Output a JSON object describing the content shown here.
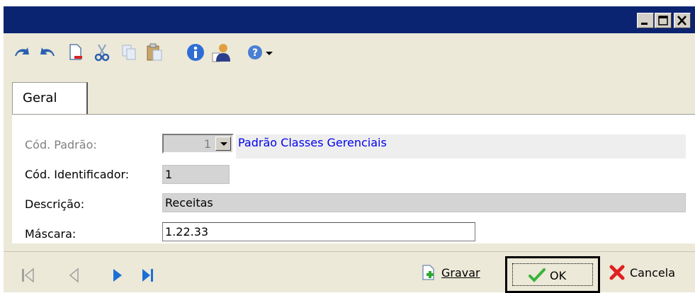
{
  "window": {
    "controls": [
      "minimize-icon",
      "maximize-icon",
      "close-icon"
    ]
  },
  "toolbar": {
    "icons": [
      "undo-icon",
      "redo-icon",
      "new-document-icon",
      "cut-icon",
      "copy-icon",
      "paste-icon",
      "info-icon",
      "user-icon",
      "help-icon",
      "dropdown-arrow-icon"
    ]
  },
  "tabs": [
    {
      "label": "Geral",
      "active": true
    }
  ],
  "form": {
    "cod_padrao": {
      "label": "Cód. Padrão:",
      "value": "1",
      "description": "Padrão Classes Gerenciais"
    },
    "cod_identificador": {
      "label": "Cód. Identificador:",
      "value": "1"
    },
    "descricao": {
      "label": "Descrição:",
      "value": "Receitas"
    },
    "mascara": {
      "label": "Máscara:",
      "value": "1.22.33"
    }
  },
  "navigation": [
    "first-record-icon",
    "previous-record-icon",
    "next-record-icon",
    "last-record-icon"
  ],
  "actions": {
    "gravar": "Gravar",
    "ok": "OK",
    "cancela": "Cancela"
  },
  "colors": {
    "titlebar": "#0a2472",
    "link": "#0000ee",
    "nav_active": "#1c6fd6",
    "nav_disabled": "#a0a0a0"
  }
}
